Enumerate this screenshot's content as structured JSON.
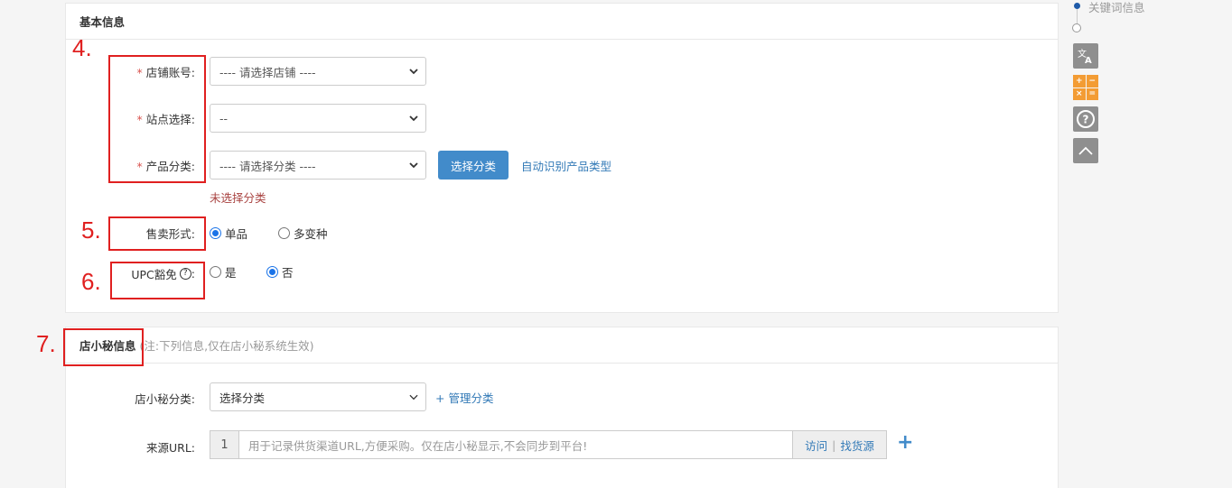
{
  "basic_info": {
    "title": "基本信息",
    "store": {
      "label": "店铺账号:",
      "placeholder": "---- 请选择店铺 ----"
    },
    "site": {
      "label": "站点选择:",
      "value": "--"
    },
    "category": {
      "label": "产品分类:",
      "placeholder": "---- 请选择分类 ----",
      "select_button": "选择分类",
      "auto_link": "自动识别产品类型",
      "error": "未选择分类"
    },
    "sale_form": {
      "label": "售卖形式:",
      "options": [
        "单品",
        "多变种"
      ],
      "selected": "单品"
    },
    "upc": {
      "label": "UPC豁免",
      "colon": ":",
      "options": [
        "是",
        "否"
      ],
      "selected": "否"
    }
  },
  "dxm_info": {
    "title": "店小秘信息",
    "note": "(注:下列信息,仅在店小秘系统生效)",
    "category": {
      "label": "店小秘分类:",
      "placeholder": "选择分类",
      "manage_link": "+ 管理分类"
    },
    "source_url": {
      "label": "来源URL:",
      "index": "1",
      "placeholder": "用于记录供货渠道URL,方便采购。仅在店小秘显示,不会同步到平台!",
      "visit": "访问",
      "separator": "|",
      "find_source": "找货源",
      "add": "+"
    }
  },
  "annotations": {
    "m4": "4.",
    "m5": "5.",
    "m6": "6.",
    "m7": "7.",
    "color": "#e02020"
  },
  "side_nav": {
    "current_label": "关键词信息",
    "tools": [
      "translate-icon",
      "calculator-icon",
      "help-icon",
      "back-to-top-icon"
    ],
    "calc_keys": [
      "+",
      "−",
      "×",
      "="
    ]
  },
  "colors": {
    "primary": "#428bca",
    "link": "#337ab7",
    "error": "#a94442",
    "required": "#d9534f",
    "radio_on": "#1a73e8"
  }
}
